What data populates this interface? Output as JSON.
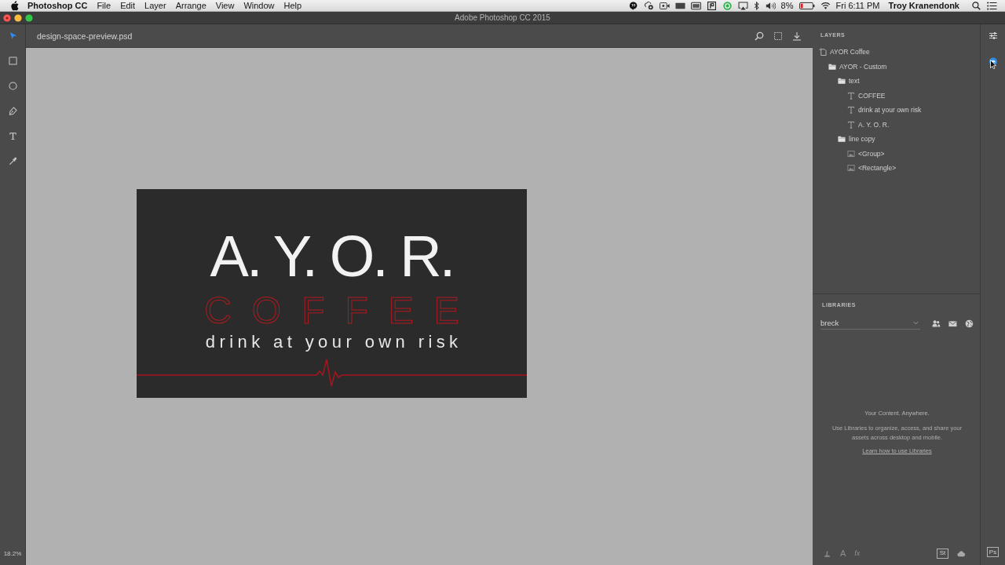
{
  "menu_bar": {
    "app_name": "Photoshop CC",
    "menus": [
      "File",
      "Edit",
      "Layer",
      "Arrange",
      "View",
      "Window",
      "Help"
    ],
    "battery": "8%",
    "clock": "Fri 6:11 PM",
    "user": "Troy Kranendonk"
  },
  "window": {
    "title": "Adobe Photoshop CC 2015"
  },
  "toolbar": {
    "tools": [
      {
        "kind": "move",
        "selected": true
      },
      {
        "kind": "rectangle",
        "selected": false
      },
      {
        "kind": "ellipse",
        "selected": false
      },
      {
        "kind": "pen",
        "selected": false
      },
      {
        "kind": "type",
        "selected": false
      },
      {
        "kind": "eyedropper",
        "selected": false
      }
    ],
    "zoom": "18.2%"
  },
  "document": {
    "file_name": "design-space-preview.psd",
    "artboard": {
      "heading": "A. Y. O. R.",
      "subheading": "COFFEE",
      "tagline": "drink at your own risk"
    }
  },
  "layers_panel": {
    "title": "LAYERS",
    "tree": [
      {
        "name": "AYOR Coffee",
        "kind": "artboard",
        "children": [
          {
            "name": "AYOR - Custom",
            "kind": "folder",
            "children": [
              {
                "name": "text",
                "kind": "folder",
                "children": [
                  {
                    "name": "COFFEE",
                    "kind": "text"
                  },
                  {
                    "name": "drink at your own risk",
                    "kind": "text"
                  },
                  {
                    "name": "A. Y. O. R.",
                    "kind": "text"
                  }
                ]
              },
              {
                "name": "line copy",
                "kind": "folder",
                "children": [
                  {
                    "name": "<Group>",
                    "kind": "image"
                  },
                  {
                    "name": "<Rectangle>",
                    "kind": "image"
                  }
                ]
              }
            ]
          }
        ]
      }
    ]
  },
  "libraries_panel": {
    "title": "LIBRARIES",
    "library": "breck",
    "empty_title": "Your Content. Anywhere.",
    "empty_text": "Use Libraries to organize, access, and share your assets across desktop and mobile.",
    "link": "Learn how to use Libraries"
  },
  "panel_footer": {
    "tools": [
      "A",
      "fx"
    ],
    "tile": "St"
  },
  "side_strip": {
    "tile": "Ps"
  }
}
